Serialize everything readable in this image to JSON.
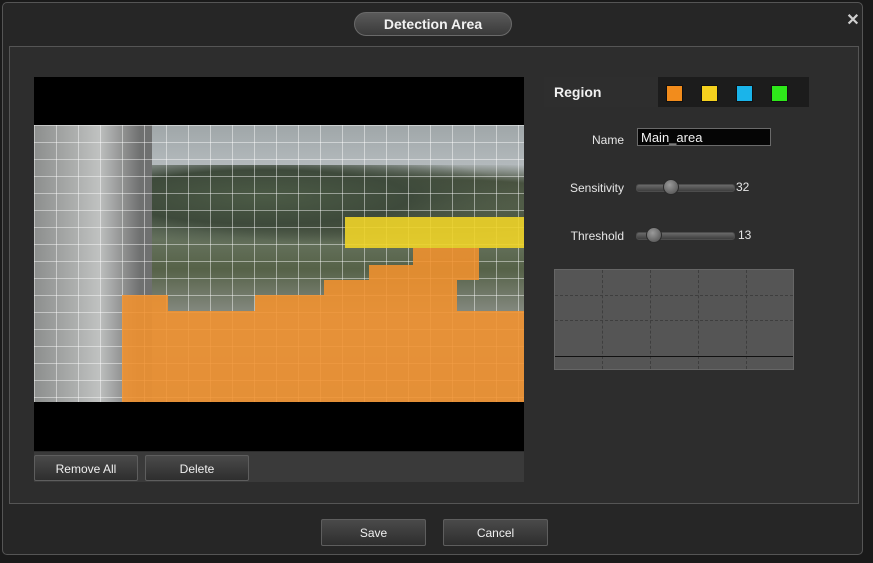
{
  "dialog": {
    "title": "Detection Area",
    "close_glyph": "✕"
  },
  "video": {
    "buttons": {
      "remove_all": "Remove All",
      "delete": "Delete"
    }
  },
  "region": {
    "label": "Region",
    "swatches": [
      {
        "name": "orange",
        "color": "#f28c1c"
      },
      {
        "name": "yellow",
        "color": "#f5d11e"
      },
      {
        "name": "blue",
        "color": "#1ab4ea"
      },
      {
        "name": "green",
        "color": "#2ee81a"
      }
    ]
  },
  "fields": {
    "name_label": "Name",
    "name_value": "Main_area",
    "sensitivity_label": "Sensitivity",
    "sensitivity_value": "32",
    "threshold_label": "Threshold",
    "threshold_value": "13"
  },
  "footer": {
    "save": "Save",
    "cancel": "Cancel"
  }
}
